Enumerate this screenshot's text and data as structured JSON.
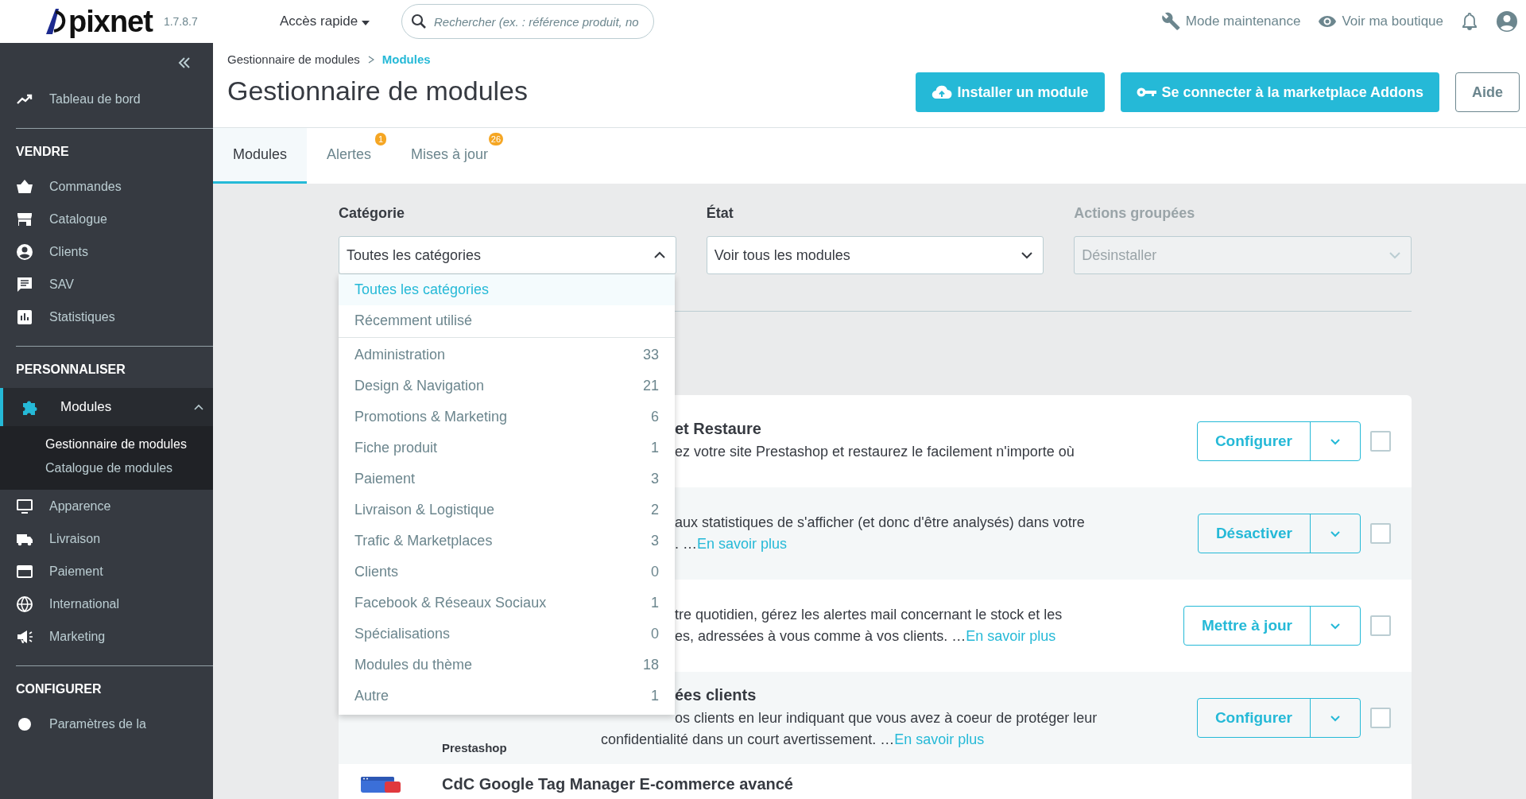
{
  "header": {
    "logo": "pixnet",
    "version": "1.7.8.7",
    "quick_access": "Accès rapide",
    "search": {
      "placeholder": "Rechercher (ex. : référence produit, no"
    },
    "links": [
      "Mode maintenance",
      "Voir ma boutique"
    ]
  },
  "sidebar": {
    "top_items": [
      {
        "label": "Tableau de bord"
      }
    ],
    "sections": [
      {
        "title": "VENDRE",
        "items": [
          {
            "label": "Commandes",
            "selected": false
          },
          {
            "label": "Catalogue",
            "selected": false
          },
          {
            "label": "Clients",
            "selected": false
          },
          {
            "label": "SAV",
            "selected": false
          },
          {
            "label": "Statistiques",
            "selected": false
          }
        ]
      },
      {
        "title": "PERSONNALISER",
        "items": [
          {
            "label": "Modules",
            "selected": true,
            "expanded": true,
            "children": [
              {
                "label": "Gestionnaire de modules",
                "selected": true
              },
              {
                "label": "Catalogue de modules",
                "selected": false
              }
            ]
          },
          {
            "label": "Apparence",
            "selected": false
          },
          {
            "label": "Livraison",
            "selected": false
          },
          {
            "label": "Paiement",
            "selected": false
          },
          {
            "label": "International",
            "selected": false
          },
          {
            "label": "Marketing",
            "selected": false
          }
        ]
      },
      {
        "title": "CONFIGURER",
        "items": [
          {
            "label": "Paramètres de la",
            "selected": false
          }
        ]
      }
    ]
  },
  "breadcrumb": [
    "Gestionnaire de modules",
    "Modules"
  ],
  "page_title": "Gestionnaire de modules",
  "toolbar": [
    "Installer un module",
    "Se connecter à la marketplace Addons"
  ],
  "help_button": "Aide",
  "tabs": [
    {
      "label": "Modules",
      "selected": true
    },
    {
      "label": "Alertes",
      "selected": false,
      "badge": "1"
    },
    {
      "label": "Mises à jour",
      "selected": false,
      "badge": "26"
    }
  ],
  "filters": [
    {
      "label": "Catégorie",
      "value": "Toutes les catégories",
      "disabled": false,
      "expanded": true
    },
    {
      "label": "État",
      "value": "Voir tous les modules",
      "disabled": false,
      "expanded": false
    },
    {
      "label": "Actions groupées",
      "value": "Désinstaller",
      "disabled": true,
      "expanded": false
    }
  ],
  "category_menu": {
    "special": [
      {
        "label": "Toutes les catégories",
        "selected": true
      },
      {
        "label": "Récemment utilisé",
        "selected": false
      }
    ],
    "categories": [
      {
        "label": "Administration",
        "count": "33"
      },
      {
        "label": "Design & Navigation",
        "count": "21"
      },
      {
        "label": "Promotions & Marketing",
        "count": "6"
      },
      {
        "label": "Fiche produit",
        "count": "1"
      },
      {
        "label": "Paiement",
        "count": "3"
      },
      {
        "label": "Livraison & Logistique",
        "count": "2"
      },
      {
        "label": "Trafic & Marketplaces",
        "count": "3"
      },
      {
        "label": "Clients",
        "count": "0"
      },
      {
        "label": "Facebook & Réseaux Sociaux",
        "count": "1"
      },
      {
        "label": "Spécialisations",
        "count": "0"
      },
      {
        "label": "Modules du thème",
        "count": "18"
      },
      {
        "label": "Autre",
        "count": "1"
      }
    ]
  },
  "modules": [
    {
      "title": "et Restaure",
      "lines": [
        {
          "text": "ez votre site Prestashop et restaurez le facilement n'importe où"
        }
      ],
      "action": "Configurer",
      "checked": false
    },
    {
      "lines": [
        {
          "text": "aux statistiques de s'afficher (et donc d'être analysés) dans votre"
        },
        {
          "text": ". …",
          "link": "En savoir plus"
        }
      ],
      "action": "Désactiver",
      "checked": false
    },
    {
      "lines": [
        {
          "text": "tre quotidien, gérez les alertes mail concernant le stock et les"
        },
        {
          "text": "es, adressées à vous comme à vos clients. …",
          "link": "En savoir plus"
        }
      ],
      "action": "Mettre à jour",
      "checked": false
    },
    {
      "title": "ées clients",
      "author": "Prestashop",
      "lines": [
        {
          "text": "os clients en leur indiquant que vous avez à coeur de protéger leur"
        },
        {
          "text": "confidentialité dans un court avertissement. …",
          "link": "En savoir plus"
        }
      ],
      "action": "Configurer",
      "checked": false
    },
    {
      "title": "CdC Google Tag Manager E-commerce avancé",
      "logo": true
    }
  ]
}
